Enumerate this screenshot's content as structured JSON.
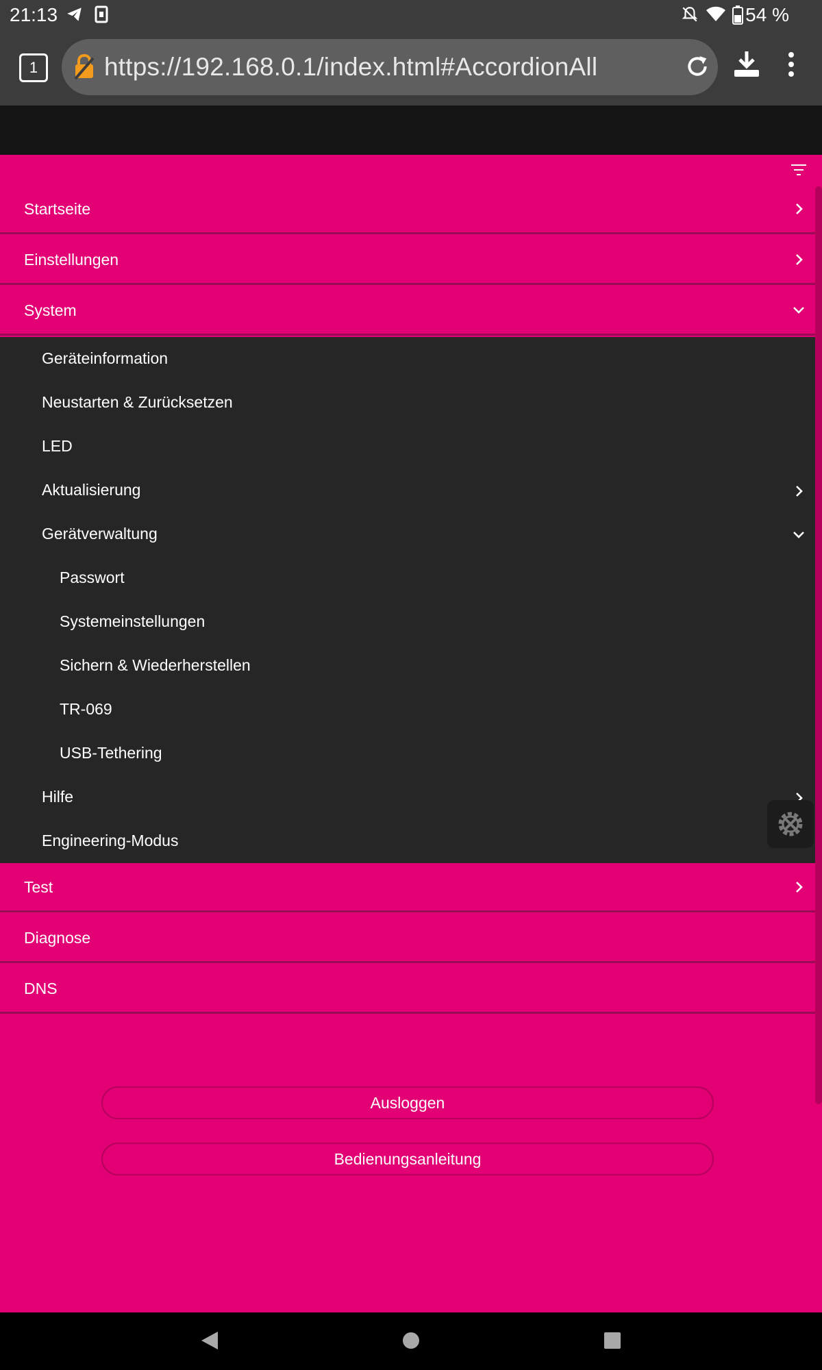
{
  "status_bar": {
    "time": "21:13",
    "battery": "54 %",
    "icons": [
      "telegram-icon",
      "sim-icon",
      "mute-icon",
      "wifi-icon",
      "battery-icon"
    ]
  },
  "browser": {
    "tab_count": "1",
    "url": "https://192.168.0.1/index.html#AccordionAll",
    "icons": [
      "insecure-lock-icon",
      "reload-icon",
      "download-icon",
      "menu-icon"
    ]
  },
  "menu": {
    "items": [
      {
        "label": "Startseite"
      },
      {
        "label": "Einstellungen"
      },
      {
        "label": "System"
      },
      {
        "label": "Test"
      },
      {
        "label": "Diagnose"
      },
      {
        "label": "DNS"
      }
    ],
    "system_children": [
      {
        "label": "Geräteinformation"
      },
      {
        "label": "Neustarten & Zurücksetzen"
      },
      {
        "label": "LED"
      },
      {
        "label": "Aktualisierung"
      },
      {
        "label": "Gerätverwaltung"
      },
      {
        "label": "Passwort"
      },
      {
        "label": "Systemeinstellungen"
      },
      {
        "label": "Sichern & Wiederherstellen"
      },
      {
        "label": "TR-069"
      },
      {
        "label": "USB-Tethering"
      },
      {
        "label": "Hilfe"
      },
      {
        "label": "Engineering-Modus"
      }
    ]
  },
  "buttons": {
    "logout": "Ausloggen",
    "manual": "Bedienungsanleitung"
  },
  "colors": {
    "brand": "#e20074",
    "submenu_bg": "#262626",
    "toolbar_bg": "#3c3c3c"
  }
}
